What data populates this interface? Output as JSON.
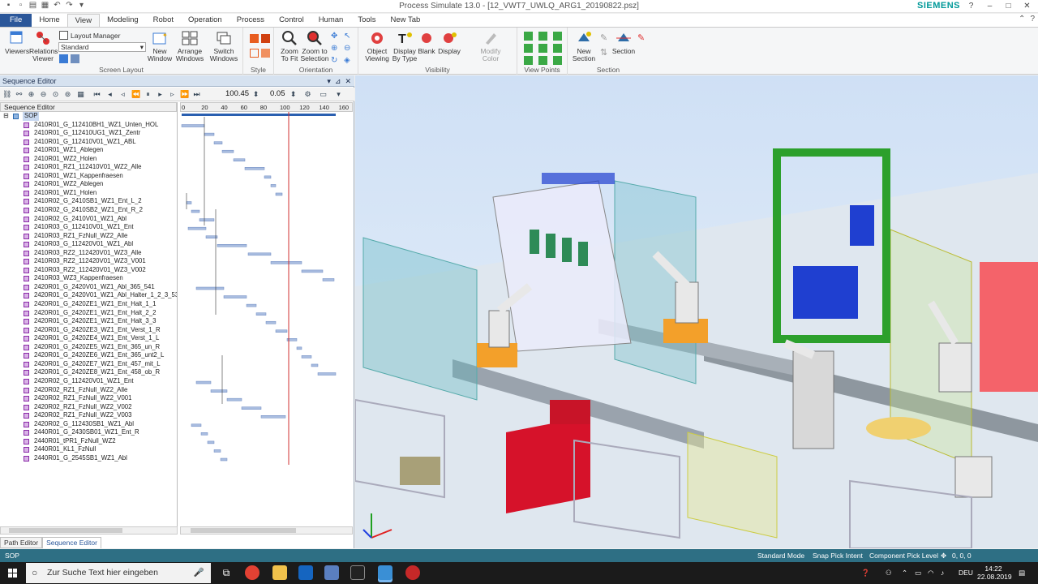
{
  "window": {
    "title": "Process Simulate 13.0 - [12_VWT7_UWLQ_ARG1_20190822.psz]",
    "brand": "SIEMENS"
  },
  "tabs": [
    "File",
    "Home",
    "View",
    "Modeling",
    "Robot",
    "Operation",
    "Process",
    "Control",
    "Human",
    "Tools",
    "New Tab"
  ],
  "active_tab": "View",
  "ribbon": {
    "screen_layout": {
      "label": "Screen Layout",
      "viewers": "Viewers",
      "relations": "Relations",
      "relations2": "Viewer",
      "layout_manager": "Layout Manager",
      "layout_value": "Standard",
      "new_window": "New",
      "new_window2": "Window",
      "arrange": "Arrange",
      "arrange2": "Windows",
      "switch": "Switch",
      "switch2": "Windows"
    },
    "style": {
      "label": "Style"
    },
    "orientation": {
      "label": "Orientation",
      "zoom_fit": "Zoom",
      "zoom_fit2": "To Fit",
      "zoom_sel": "Zoom to",
      "zoom_sel2": "Selection"
    },
    "visibility": {
      "label": "Visibility",
      "object_viewing": "Object",
      "object_viewing2": "Viewing",
      "display_by_type": "Display",
      "display_by_type2": "By Type",
      "blank": "Blank",
      "display": "Display",
      "modify_color": "Modify",
      "modify_color2": "Color"
    },
    "view_points": {
      "label": "View Points"
    },
    "section": {
      "label": "Section",
      "new_section": "New",
      "new_section2": "Section",
      "section": "Section"
    }
  },
  "sequence_editor": {
    "title": "Sequence Editor",
    "time_value": "100.45",
    "step_value": "0.05",
    "tree_header": "Sequence Editor",
    "root": "SOP",
    "axis_ticks": [
      "0",
      "20",
      "40",
      "60",
      "80",
      "100",
      "120",
      "140",
      "160"
    ],
    "operations": [
      "2410R01_G_112410BH1_WZ1_Unten_HOL",
      "2410R01_G_112410UG1_WZ1_Zentr",
      "2410R01_G_112410V01_WZ1_ABL",
      "2410R01_WZ1_Ablegen",
      "2410R01_WZ2_Holen",
      "2410R01_RZ1_112410V01_WZ2_Alle",
      "2410R01_WZ1_Kappenfraesen",
      "2410R01_WZ2_Ablegen",
      "2410R01_WZ1_Holen",
      "2410R02_G_2410SB1_WZ1_Ent_L_2",
      "2410R02_G_2410SB2_WZ1_Ent_R_2",
      "2410R02_G_2410V01_WZ1_Abl",
      "2410R03_G_112410V01_WZ1_Ent",
      "2410R03_RZ1_FzNull_WZ2_Alle",
      "2410R03_G_112420V01_WZ1_Abl",
      "2410R03_RZ2_112420V01_WZ3_Alle",
      "2410R03_RZ2_112420V01_WZ3_V001",
      "2410R03_RZ2_112420V01_WZ3_V002",
      "2410R03_WZ3_Kappenfraesen",
      "2420R01_G_2420V01_WZ1_Abl_365_541",
      "2420R01_G_2420V01_WZ1_Abl_Halter_1_2_3_537_5",
      "2420R01_G_2420ZE1_WZ1_Ent_Halt_1_1",
      "2420R01_G_2420ZE1_WZ1_Ent_Halt_2_2",
      "2420R01_G_2420ZE1_WZ1_Ent_Halt_3_3",
      "2420R01_G_2420ZE3_WZ1_Ent_Verst_1_R",
      "2420R01_G_2420ZE4_WZ1_Ent_Verst_1_L",
      "2420R01_G_2420ZE5_WZ1_Ent_365_un_R",
      "2420R01_G_2420ZE6_WZ1_Ent_365_unt2_L",
      "2420R01_G_2420ZE7_WZ1_Ent_457_mit_L",
      "2420R01_G_2420ZE8_WZ1_Ent_458_ob_R",
      "2420R02_G_112420V01_WZ1_Ent",
      "2420R02_RZ1_FzNull_WZ2_Alle",
      "2420R02_RZ1_FzNull_WZ2_V001",
      "2420R02_RZ1_FzNull_WZ2_V002",
      "2420R02_RZ1_FzNull_WZ2_V003",
      "2420R02_G_112430SB1_WZ1_Abl",
      "2440R01_G_2430SB01_WZ1_Ent_R",
      "2440R01_tPR1_FzNull_WZ2",
      "2440R01_KL1_FzNull",
      "2440R01_G_2545SB1_WZ1_Abl"
    ],
    "bottom_tabs": [
      "Path Editor",
      "Sequence Editor"
    ]
  },
  "statusbar": {
    "left": "SOP",
    "mode": "Standard Mode",
    "snap": "Snap Pick Intent",
    "pick": "Component Pick Level",
    "coords": "0, 0, 0"
  },
  "taskbar": {
    "search_placeholder": "Zur Suche Text hier eingeben",
    "lang": "DEU",
    "time": "14:22",
    "date": "22.08.2019"
  }
}
